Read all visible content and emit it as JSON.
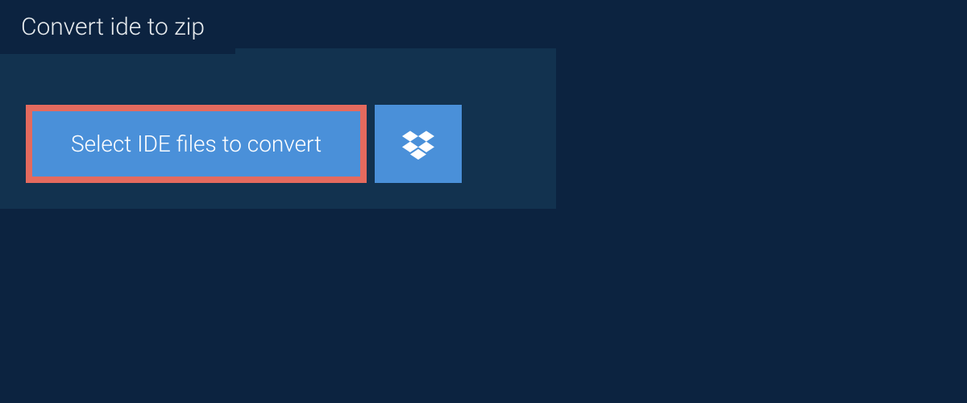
{
  "tab": {
    "title": "Convert ide to zip"
  },
  "actions": {
    "select_label": "Select IDE files to convert",
    "dropbox_icon": "dropbox-icon"
  },
  "colors": {
    "background": "#0c2340",
    "panel": "#12324f",
    "button": "#4a90d9",
    "highlight_border": "#e46a5e",
    "text_light": "#e8ecef"
  }
}
